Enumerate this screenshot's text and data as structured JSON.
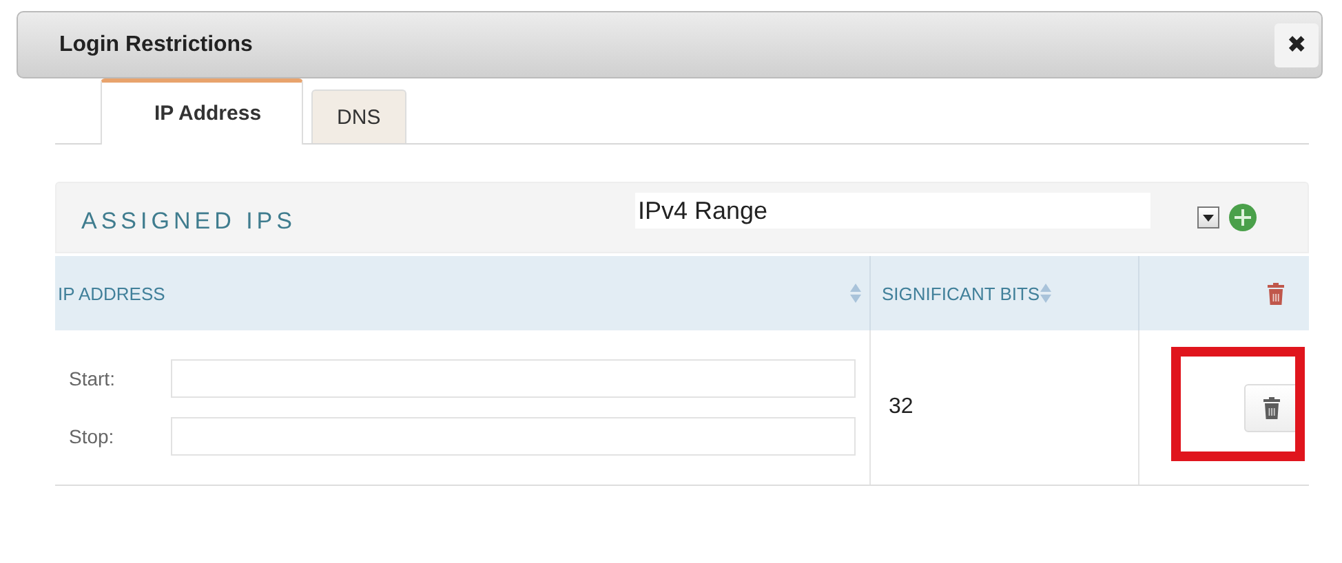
{
  "window": {
    "title": "Login Restrictions",
    "close": "✖"
  },
  "tabs": [
    {
      "label": "IP Address",
      "selected": true
    },
    {
      "label": "DNS",
      "selected": false
    }
  ],
  "section": {
    "title": "ASSIGNED IPS",
    "type_select": {
      "value": "IPv4 Range"
    }
  },
  "table": {
    "columns": [
      "IP ADDRESS",
      "SIGNIFICANT BITS"
    ],
    "rows": [
      {
        "fields": [
          {
            "label": "Start:"
          },
          {
            "label": "Stop:"
          }
        ],
        "significant_bits": "32",
        "highlighted": true
      }
    ]
  }
}
